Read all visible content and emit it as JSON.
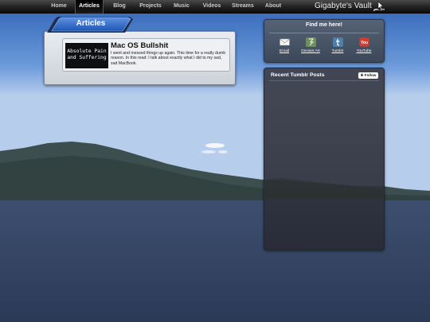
{
  "nav": {
    "items": [
      {
        "label": "Home",
        "active": false
      },
      {
        "label": "Articles",
        "active": true
      },
      {
        "label": "Blog",
        "active": false
      },
      {
        "label": "Projects",
        "active": false
      },
      {
        "label": "Music",
        "active": false
      },
      {
        "label": "Videos",
        "active": false
      },
      {
        "label": "Streams",
        "active": false
      },
      {
        "label": "About",
        "active": false
      }
    ],
    "site_title": "Gigabyte's Vault",
    "title_icon": "pointer-wing-icon"
  },
  "articles": {
    "header": "Articles",
    "items": [
      {
        "thumb_text": [
          "Absolute Pain",
          "and Suffering"
        ],
        "title": "Mac OS Bullshit",
        "description": "I went and messed things up again. This time for a really dumb reason. In this read: I talk about exactly what I did to my sad, sad MacBook."
      }
    ]
  },
  "find_me": {
    "title": "Find me here!",
    "links": [
      {
        "label": "Email",
        "icon": "envelope-icon",
        "color": "#f2f2f2"
      },
      {
        "label": "Deviant Art",
        "icon": "deviantart-icon",
        "color": "#6d8f5f"
      },
      {
        "label": "Tumblr",
        "icon": "tumblr-icon",
        "color": "#4f7ea6"
      },
      {
        "label": "YouTube",
        "icon": "youtube-icon",
        "color": "#d63b2f"
      }
    ]
  },
  "tumblr": {
    "title": "Recent Tumblr Posts",
    "follow_label": "Follow"
  },
  "colors": {
    "topbar": "#1e1e1e",
    "articles_tab": "#2a66c9",
    "panel_dark": "#3c475a"
  }
}
